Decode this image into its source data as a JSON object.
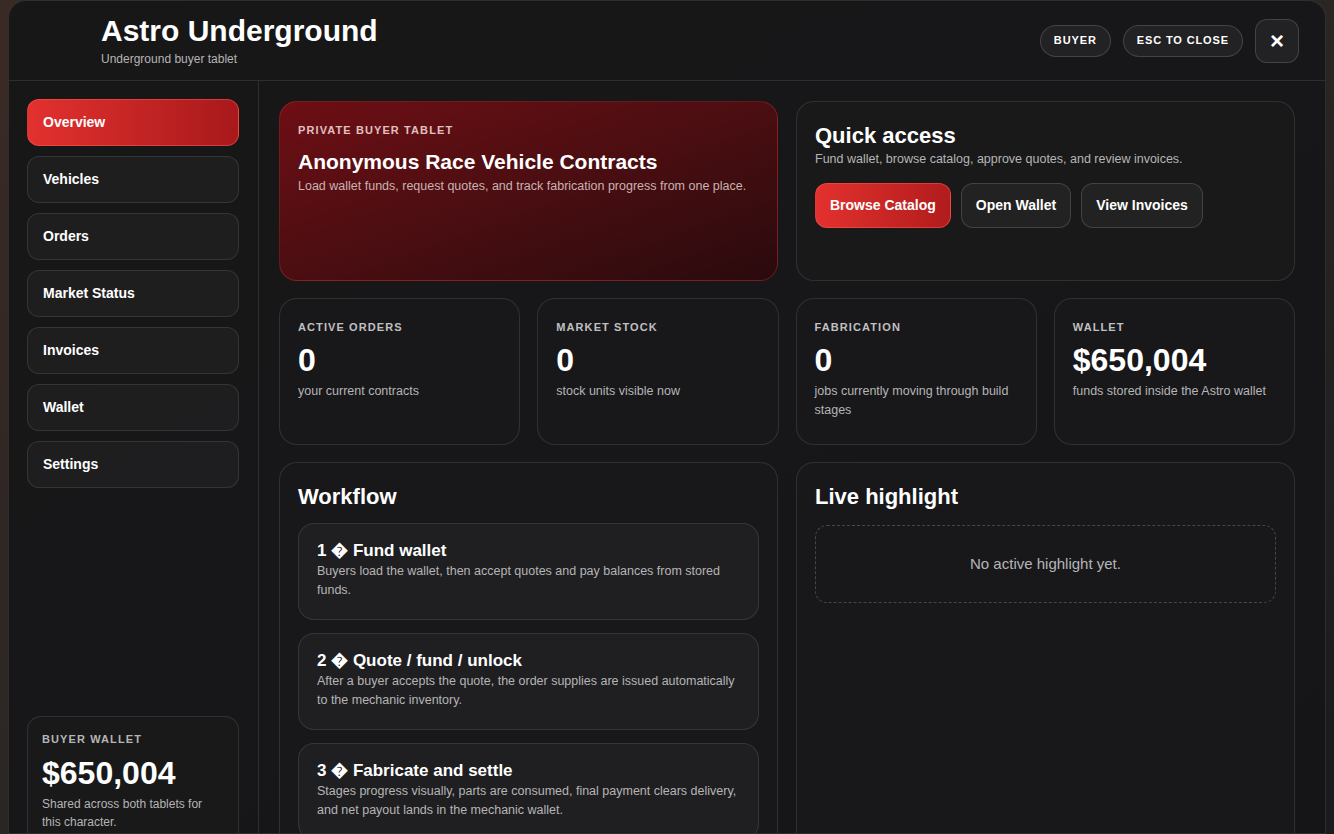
{
  "header": {
    "title": "Astro Underground",
    "subtitle": "Underground buyer tablet",
    "badges": [
      "BUYER",
      "ESC TO CLOSE"
    ],
    "close": "×"
  },
  "sidebar": {
    "items": [
      {
        "label": "Overview",
        "selected": true
      },
      {
        "label": "Vehicles",
        "selected": false
      },
      {
        "label": "Orders",
        "selected": false
      },
      {
        "label": "Market Status",
        "selected": false
      },
      {
        "label": "Invoices",
        "selected": false
      },
      {
        "label": "Wallet",
        "selected": false
      },
      {
        "label": "Settings",
        "selected": false
      }
    ],
    "wallet": {
      "label": "BUYER WALLET",
      "amount": "$650,004",
      "note": "Shared across both tablets for this character."
    }
  },
  "hero": {
    "eyebrow": "PRIVATE BUYER TABLET",
    "title": "Anonymous Race Vehicle Contracts",
    "description": "Load wallet funds, request quotes, and track fabrication progress from one place."
  },
  "quick_access": {
    "title": "Quick access",
    "description": "Fund wallet, browse catalog, approve quotes, and review invoices.",
    "buttons": [
      {
        "label": "Browse Catalog",
        "kind": "primary"
      },
      {
        "label": "Open Wallet",
        "kind": "secondary"
      },
      {
        "label": "View Invoices",
        "kind": "secondary"
      }
    ]
  },
  "stats": [
    {
      "label": "ACTIVE ORDERS",
      "value": "0",
      "note": "your current contracts"
    },
    {
      "label": "MARKET STOCK",
      "value": "0",
      "note": "stock units visible now"
    },
    {
      "label": "FABRICATION",
      "value": "0",
      "note": "jobs currently moving through build stages"
    },
    {
      "label": "WALLET",
      "value": "$650,004",
      "note": "funds stored inside the Astro wallet"
    }
  ],
  "workflow": {
    "title": "Workflow",
    "steps": [
      {
        "title": "1 � Fund wallet",
        "description": "Buyers load the wallet, then accept quotes and pay balances from stored funds."
      },
      {
        "title": "2 � Quote / fund / unlock",
        "description": "After a buyer accepts the quote, the order supplies are issued automatically to the mechanic inventory."
      },
      {
        "title": "3 � Fabricate and settle",
        "description": "Stages progress visually, parts are consumed, final payment clears delivery, and net payout lands in the mechanic wallet."
      }
    ]
  },
  "highlight": {
    "title": "Live highlight",
    "empty": "No active highlight yet."
  }
}
